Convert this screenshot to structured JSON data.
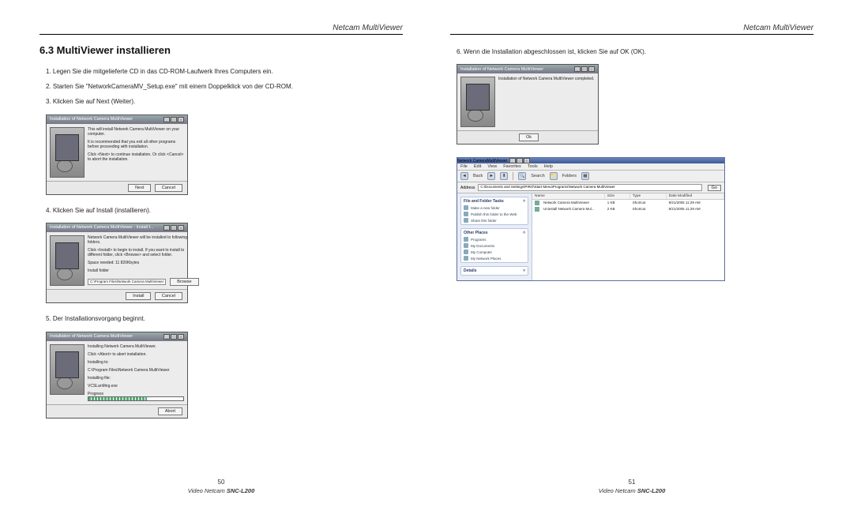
{
  "header": "Netcam MultiViewer",
  "section_title": "6.3 MultiViewer installieren",
  "steps": {
    "s1": "1. Legen Sie die mitgelieferte CD in das CD-ROM-Laufwerk Ihres Computers ein.",
    "s2": "2. Starten Sie \"NetworkCameraMV_Setup.exe\" mit einem Doppelklick von der CD-ROM.",
    "s3": "3. Klicken Sie auf Next (Weiter).",
    "s4": "4. Klicken Sie auf Install (installieren).",
    "s5": "5. Der Installationsvorgang beginnt.",
    "s6": "6. Wenn die Installation abgeschlossen ist, klicken Sie auf OK (OK)."
  },
  "dialog1": {
    "title": "Installation of Network Camera MultiViewer",
    "line1": "This will install Network Camera MultiViewer on your computer.",
    "line2": "It is recommended that you exit all other programs before proceeding with installation.",
    "line3": "Click <Next> to continue installation. Or click <Cancel> to abort the installation.",
    "btn_next": "Next",
    "btn_cancel": "Cancel"
  },
  "dialog2": {
    "title": "Installation of Network Camera MultiViewer : Install f...",
    "line1": "Network Camera MultiViewer will be installed to following folders.",
    "line2": "Click <Install> to begin to install. If you want to install to different folder, click <Browse> and select folder.",
    "space": "Space needed: 11 820Kbytes",
    "folder_label": "Install folder",
    "folder_path": "C:\\Program Files\\Network Camera MultiViewer",
    "btn_browse": "Browse",
    "btn_install": "Install",
    "btn_cancel": "Cancel"
  },
  "dialog3": {
    "title": "Installation of Network Camera MultiViewer",
    "line1": "Installing Network Camera MultiViewer.",
    "line2": "Click <Abort> to abort installation.",
    "installing_to_label": "Installing to:",
    "installing_to": "C:\\Program Files\\Network Camera MultiViewer",
    "installing_file_label": "Installing file:",
    "installing_file": "VCSLanMng.exe",
    "progress_label": "Progress",
    "btn_abort": "Abort"
  },
  "dialog4": {
    "title": "Installation of Network Camera MultiViewer",
    "line1": "Installation of Network Camera MultiViewer completed.",
    "btn_ok": "Ok"
  },
  "explorer": {
    "title": "Network CameraMultiViewer",
    "menu": {
      "file": "File",
      "edit": "Edit",
      "view": "View",
      "favorites": "Favorites",
      "tools": "Tools",
      "help": "Help"
    },
    "toolbar": {
      "back": "Back",
      "search": "Search",
      "folders": "Folders"
    },
    "address_label": "Address",
    "address": "C:\\Documents and Settings\\PIRO\\Start Menu\\Programs\\Network Camera MultiViewer",
    "go": "Go",
    "tasks": {
      "g1_title": "File and Folder Tasks",
      "g1_items": [
        "Make a new folder",
        "Publish this folder to the Web",
        "Share this folder"
      ],
      "g2_title": "Other Places",
      "g2_items": [
        "Programs",
        "My Documents",
        "My Computer",
        "My Network Places"
      ],
      "g3_title": "Details"
    },
    "cols": {
      "name": "Name",
      "size": "Size",
      "type": "Type",
      "modified": "Date Modified"
    },
    "rows": [
      {
        "name": "Network Camera MultiViewer",
        "size": "1 KB",
        "type": "Shortcut",
        "modified": "9/21/2005 11:29 AM"
      },
      {
        "name": "Uninstall Network Camera Mul...",
        "size": "2 KB",
        "type": "Shortcut",
        "modified": "9/21/2005 11:29 AM"
      }
    ]
  },
  "footer": {
    "page_left": "50",
    "page_right": "51",
    "model_prefix": "Video Netcam ",
    "model_bold": "SNC-L200"
  }
}
